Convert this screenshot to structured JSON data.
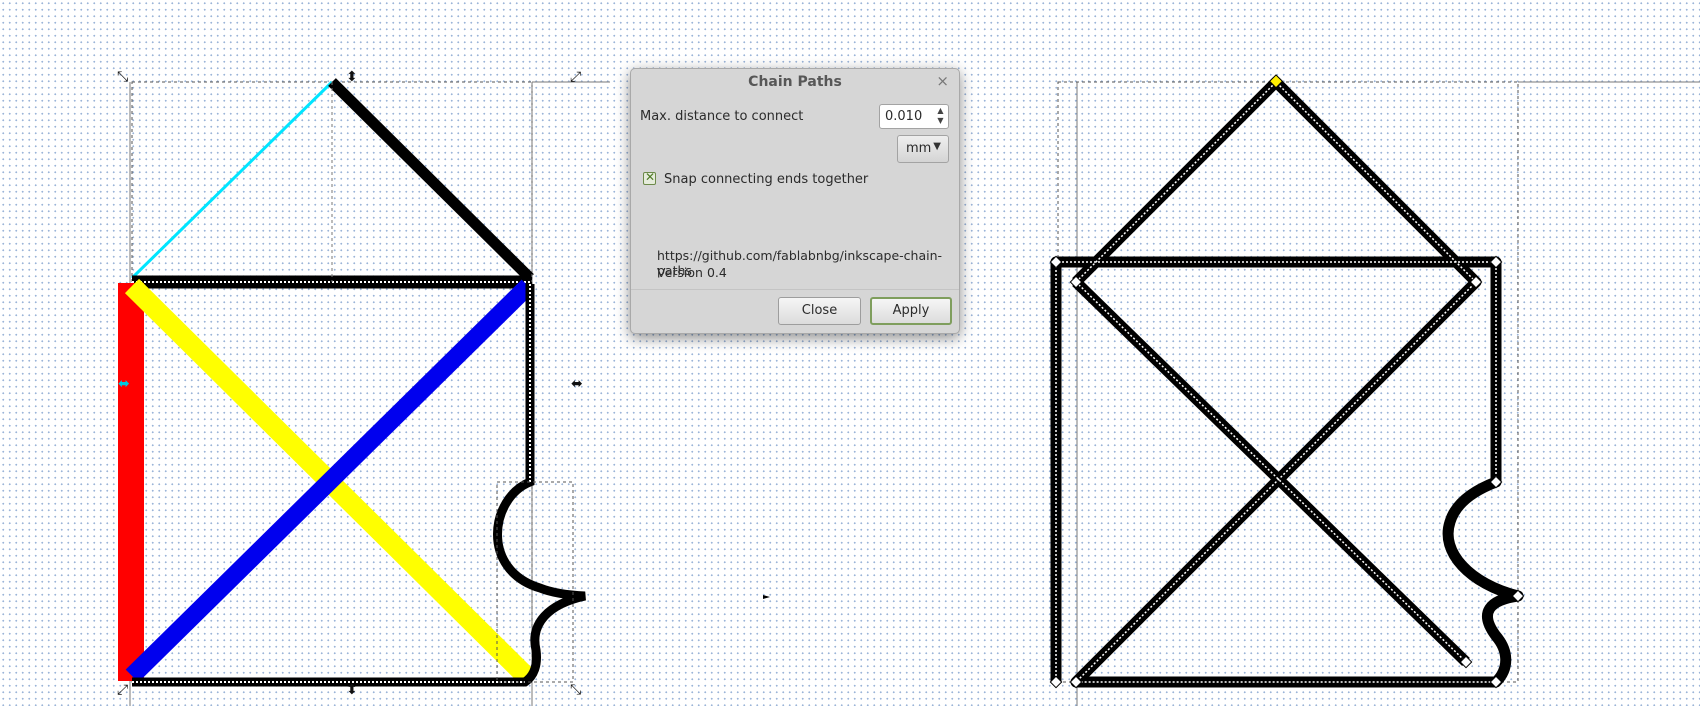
{
  "dialog": {
    "title": "Chain Paths",
    "close_glyph": "×",
    "max_distance_label": "Max. distance to connect",
    "max_distance_value": "0.010",
    "unit": "mm",
    "snap_label": "Snap connecting ends together",
    "snap_checked": true,
    "url": "https://github.com/fablabnbg/inkscape-chain-paths",
    "version": "Version 0.4",
    "close_button": "Close",
    "apply_button": "Apply"
  },
  "colors": {
    "cyan": "#00e5ff",
    "red": "#ff0000",
    "yellow": "#ffff00",
    "blue": "#0000ee",
    "black": "#000000",
    "dialog_bg": "#d6d6d6",
    "accent_green": "#7f9e5d"
  },
  "icons": {
    "spin_up": "▲",
    "spin_down": "▼",
    "dropdown": "▼",
    "checkmark": "✕"
  }
}
